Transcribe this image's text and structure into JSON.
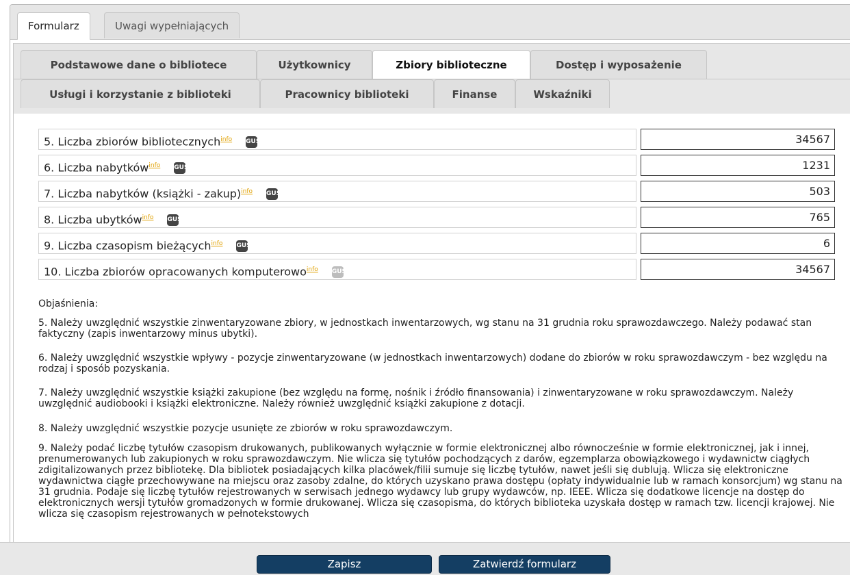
{
  "top_tabs": [
    {
      "label": "Formularz",
      "active": true
    },
    {
      "label": "Uwagi wypełniających",
      "active": false
    }
  ],
  "content_tabs_row1": [
    {
      "label": "Podstawowe dane o bibliotece",
      "active": false
    },
    {
      "label": "Użytkownicy",
      "active": false
    },
    {
      "label": "Zbiory biblioteczne",
      "active": true
    },
    {
      "label": "Dostęp i wyposażenie",
      "active": false
    }
  ],
  "content_tabs_row2": [
    {
      "label": "Usługi i korzystanie z biblioteki",
      "active": false
    },
    {
      "label": "Pracownicy biblioteki",
      "active": false
    },
    {
      "label": "Finanse",
      "active": false
    },
    {
      "label": "Wskaźniki",
      "active": false
    }
  ],
  "info_label": "info",
  "gus_label": "GUS",
  "fields": [
    {
      "label": "5. Liczba zbiorów bibliotecznych",
      "value": "34567"
    },
    {
      "label": "6. Liczba nabytków",
      "value": "1231"
    },
    {
      "label": "7. Liczba nabytków (książki - zakup)",
      "value": "503"
    },
    {
      "label": "8. Liczba ubytków",
      "value": "765"
    },
    {
      "label": "9. Liczba czasopism bieżących",
      "value": "6"
    },
    {
      "label": "10. Liczba zbiorów opracowanych komputerowo",
      "value": "34567"
    }
  ],
  "explanations": {
    "heading": "Objaśnienia:",
    "items": [
      "5. Należy uwzględnić wszystkie zinwentaryzowane zbiory, w jednostkach inwentarzowych, wg stanu na 31 grudnia roku sprawozdawczego. Należy podawać stan faktyczny (zapis inwentarzowy minus ubytki).",
      "6. Należy uwzględnić wszystkie wpływy - pozycje zinwentaryzowane (w jednostkach inwentarzowych) dodane do zbiorów w roku sprawozdawczym - bez względu na rodzaj i sposób pozyskania.",
      "7. Należy uwzględnić wszystkie książki zakupione (bez względu na formę, nośnik i źródło finansowania) i zinwentaryzowane w roku sprawozdawczym. Należy uwzględnić audiobooki i książki elektroniczne. Należy również uwzględnić książki zakupione z dotacji.",
      "8. Należy uwzględnić wszystkie pozycje usunięte ze zbiorów w roku sprawozdawczym.",
      "9. Należy podać liczbę tytułów czasopism drukowanych, publikowanych wyłącznie w formie elektronicznej albo równocześnie w formie elektronicznej, jak i innej, prenumerowanych lub zakupionych w roku sprawozdawczym. Nie wlicza się tytułów pochodzących z darów, egzemplarza obowiązkowego i wydawnictw ciągłych zdigitalizowanych przez bibliotekę. Dla bibliotek posiadających kilka placówek/filii sumuje się liczbę tytułów, nawet jeśli się dublują. Wlicza się elektroniczne wydawnictwa ciągłe przechowywane na miejscu oraz zasoby zdalne, do których uzyskano prawa dostępu (opłaty indywidualnie lub w ramach konsorcjum) wg stanu na 31 grudnia. Podaje się liczbę tytułów rejestrowanych w serwisach jednego wydawcy lub grupy wydawców, np. IEEE. Wlicza się dodatkowe licencje na dostęp do elektronicznych wersji tytułów gromadzonych w formie drukowanej. Wlicza się czasopisma, do których biblioteka uzyskała dostęp w ramach tzw. licencji krajowej. Nie wlicza się czasopism rejestrowanych w pełnotekstowych"
    ]
  },
  "footer": {
    "save_label": "Zapisz",
    "confirm_label": "Zatwierdź formularz"
  }
}
